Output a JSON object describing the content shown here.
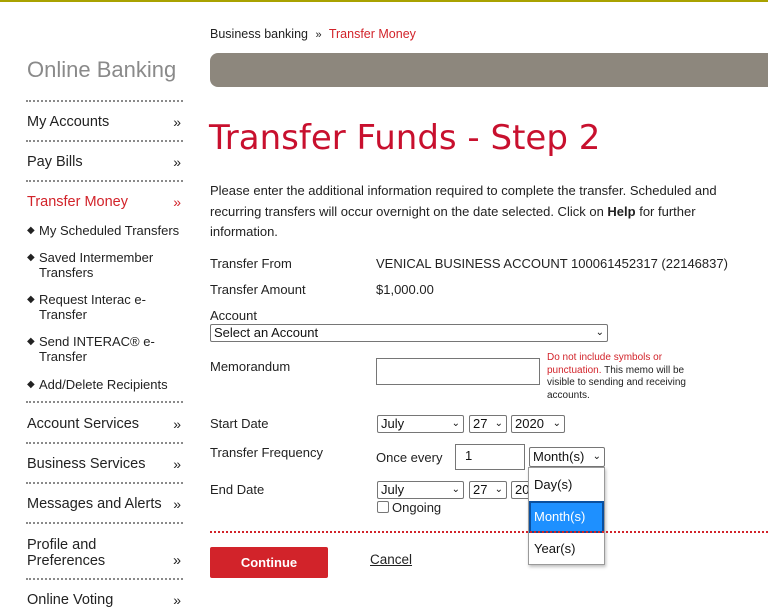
{
  "sidebar": {
    "title": "Online Banking",
    "nav": [
      {
        "label": "My Accounts",
        "chevron": "»"
      },
      {
        "label": "Pay Bills",
        "chevron": "»"
      },
      {
        "label": "Transfer Money",
        "chevron": "»"
      },
      {
        "label": "Account Services",
        "chevron": "»"
      },
      {
        "label": "Business Services",
        "chevron": "»"
      },
      {
        "label": "Messages and Alerts",
        "chevron": "»"
      },
      {
        "label": "Profile and Preferences",
        "chevron": "»"
      },
      {
        "label": "Online Voting",
        "chevron": "»"
      }
    ],
    "sub_items": [
      "My Scheduled Transfers",
      "Saved Intermember Transfers",
      "Request Interac e-Transfer",
      "Send INTERAC® e-Transfer",
      "Add/Delete Recipients"
    ],
    "bullet": "◆"
  },
  "breadcrumb": {
    "parent": "Business banking",
    "separator": "»",
    "current": "Transfer Money"
  },
  "page": {
    "title": "Transfer Funds - Step 2",
    "intro_prefix": "Please enter the additional information required to complete the transfer. Scheduled and recurring transfers will occur overnight on the date selected. Click on ",
    "intro_help": "Help",
    "intro_suffix": " for further information."
  },
  "form": {
    "transfer_from_label": "Transfer From",
    "transfer_from_value": "VENICAL BUSINESS ACCOUNT 100061452317 (22146837)",
    "transfer_amount_label": "Transfer Amount",
    "transfer_amount_value": "$1,000.00",
    "account_label": "Account",
    "account_select_value": "Select an Account",
    "memo_label": "Memorandum",
    "memo_value": "",
    "memo_note_red": "Do not include symbols or punctuation.",
    "memo_note_black": " This memo will be visible to sending and receiving accounts.",
    "start_date_label": "Start Date",
    "start_month": "July",
    "start_day": "27",
    "start_year": "2020",
    "frequency_label": "Transfer Frequency",
    "once_every_label": "Once every",
    "frequency_value": "1",
    "frequency_unit": "Month(s)",
    "frequency_options": [
      "Day(s)",
      "Month(s)",
      "Year(s)"
    ],
    "frequency_selected_index": 1,
    "end_date_label": "End Date",
    "end_month": "July",
    "end_day": "27",
    "end_year_partial": "20",
    "ongoing_label": "Ongoing",
    "ongoing_checked": false,
    "caret": "⌄"
  },
  "actions": {
    "continue_label": "Continue",
    "cancel_label": "Cancel"
  },
  "colors": {
    "accent_red": "#d2232a",
    "title_red": "#c8102e",
    "banner_taupe": "#8d877d",
    "top_line": "#a9a200",
    "selected_option": "#1e90ff"
  }
}
